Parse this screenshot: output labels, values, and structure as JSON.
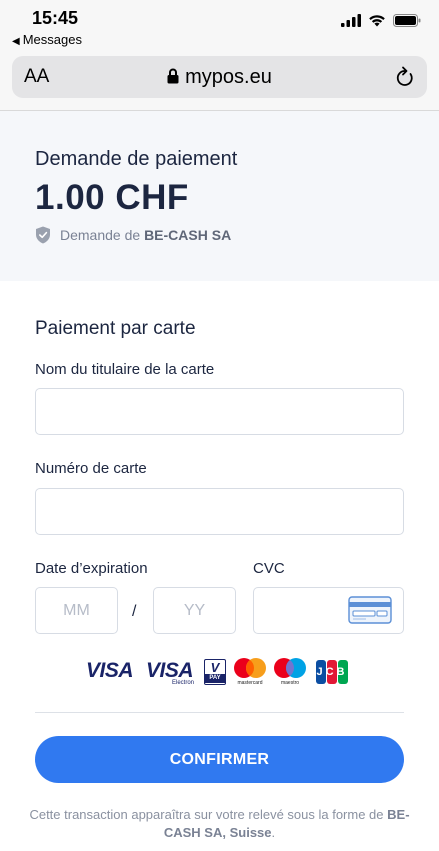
{
  "status_bar": {
    "time": "15:45",
    "back_label": "Messages"
  },
  "browser": {
    "aa_label": "AA",
    "domain": "mypos.eu"
  },
  "header": {
    "title": "Demande de paiement",
    "amount": "1.00 CHF",
    "merchant_prefix": "Demande de",
    "merchant_name": "BE-CASH SA"
  },
  "form": {
    "section_title": "Paiement par carte",
    "cardholder_label": "Nom du titulaire de la carte",
    "cardholder_value": "",
    "card_number_label": "Numéro de carte",
    "card_number_value": "",
    "expiry_label": "Date d’expiration",
    "month_placeholder": "MM",
    "separator": "/",
    "year_placeholder": "YY",
    "cvc_label": "CVC",
    "cvc_value": ""
  },
  "logos": [
    "visa-logo",
    "visa-electron-logo",
    "v-pay-logo",
    "mastercard-logo",
    "maestro-logo",
    "jcb-logo"
  ],
  "logo_text": {
    "visa": "VISA",
    "electron": "Electron",
    "vpay_v": "V",
    "vpay_pay": "PAY",
    "mastercard": "mastercard",
    "maestro": "maestro",
    "jcb": "JCB"
  },
  "confirm_label": "CONFIRMER",
  "footer": {
    "note_text": "Cette transaction apparaîtra sur votre relevé sous la forme de",
    "note_merchant": "BE-CASH SA, Suisse",
    "note_end": "."
  },
  "colors": {
    "accent": "#3079f0",
    "text": "#1c2640",
    "muted": "#8a91a0",
    "header_bg": "#f5f7fa"
  }
}
